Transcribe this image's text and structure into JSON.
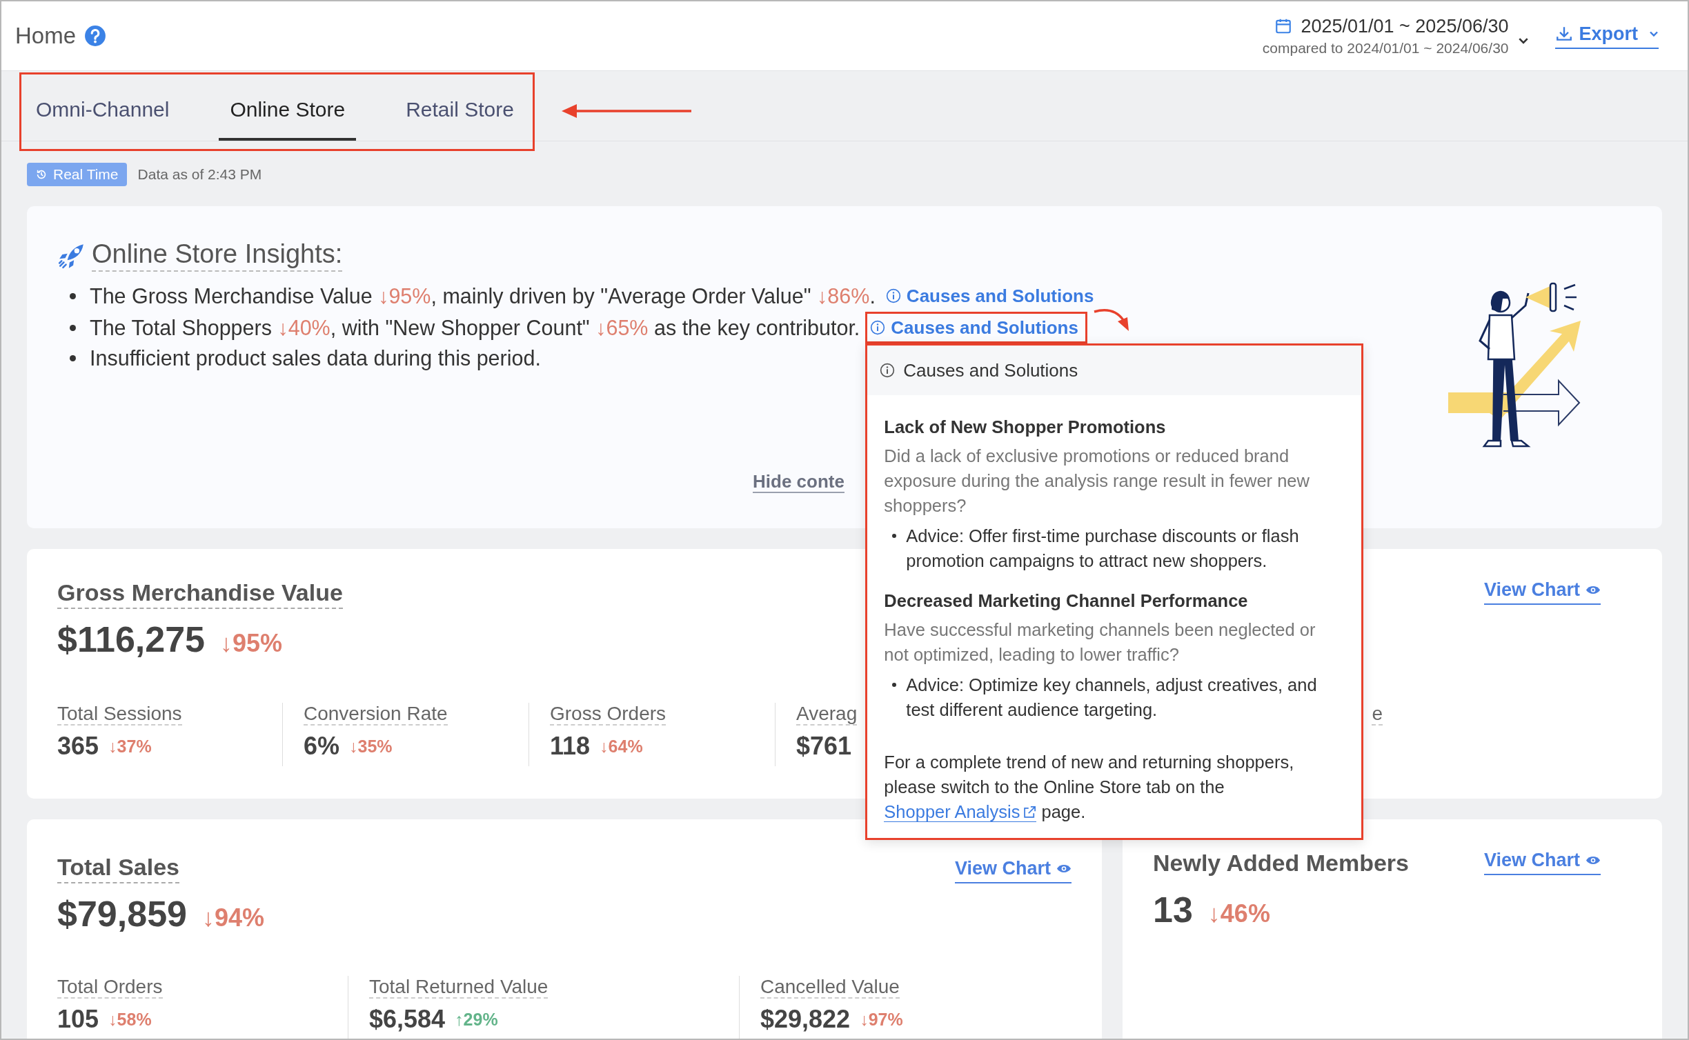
{
  "header": {
    "title": "Home",
    "date_range": "2025/01/01 ~ 2025/06/30",
    "comparison": "compared to 2024/01/01 ~ 2024/06/30",
    "export": "Export"
  },
  "tabs": [
    {
      "label": "Omni-Channel",
      "selected": false
    },
    {
      "label": "Online Store",
      "selected": true
    },
    {
      "label": "Retail Store",
      "selected": false
    }
  ],
  "status": {
    "badge": "Real Time",
    "as_of": "Data as of 2:43 PM"
  },
  "insights": {
    "title": "Online Store Insights:",
    "bullets": [
      {
        "parts": [
          {
            "kind": "text",
            "text": "The Gross Merchandise Value "
          },
          {
            "kind": "trend",
            "text": "↓95%",
            "color": "#de7f6e"
          },
          {
            "kind": "text",
            "text": ", mainly driven by \"Average Order Value\" "
          },
          {
            "kind": "trend",
            "text": "↓86%",
            "color": "#de7f6e"
          },
          {
            "kind": "text",
            "text": "."
          }
        ],
        "link": "Causes and Solutions",
        "popover_open": false
      },
      {
        "parts": [
          {
            "kind": "text",
            "text": "The Total Shoppers "
          },
          {
            "kind": "trend",
            "text": "↓40%",
            "color": "#de7f6e"
          },
          {
            "kind": "text",
            "text": ", with \"New Shopper Count\" "
          },
          {
            "kind": "trend",
            "text": "↓65%",
            "color": "#de7f6e"
          },
          {
            "kind": "text",
            "text": " as the key contributor."
          }
        ],
        "link": "Causes and Solutions",
        "popover_open": true
      },
      {
        "parts": [
          {
            "kind": "text",
            "text": "Insufficient product sales data during this period."
          }
        ]
      }
    ],
    "hide_toggle": "Hide conte"
  },
  "popover": {
    "title": "Causes and Solutions",
    "sections": [
      {
        "heading": "Lack of New Shopper Promotions",
        "question": "Did a lack of exclusive promotions or reduced brand exposure during the analysis range result in fewer new shoppers?",
        "advice": "Advice: Offer first-time purchase discounts or flash promotion campaigns to attract new shoppers."
      },
      {
        "heading": "Decreased Marketing Channel Performance",
        "question": "Have successful marketing channels been neglected or not optimized, leading to lower traffic?",
        "advice": "Advice: Optimize key channels, adjust creatives, and test different audience targeting."
      }
    ],
    "footer": "For a complete trend of new and returning shoppers, please switch to the Online Store tab on the ",
    "link": "Shopper Analysis",
    "footer_end": " page."
  },
  "gmv_card": {
    "title": "Gross Merchandise Value",
    "value": "$116,275",
    "trend": {
      "text": "↓95%",
      "color": "#de7f6e"
    },
    "view_chart": "View Chart",
    "metrics": [
      {
        "label": "Total Sessions",
        "value": "365",
        "trend": {
          "text": "↓37%",
          "color": "#de7f6e"
        }
      },
      {
        "label": "Conversion Rate",
        "value": "6%",
        "trend": {
          "text": "↓35%",
          "color": "#de7f6e"
        }
      },
      {
        "label": "Gross Orders",
        "value": "118",
        "trend": {
          "text": "↓64%",
          "color": "#de7f6e"
        }
      },
      {
        "label": "Averag",
        "value": "$761"
      },
      {
        "label": "e"
      }
    ]
  },
  "sales_card": {
    "title": "Total Sales",
    "value": "$79,859",
    "trend": {
      "text": "↓94%",
      "color": "#de7f6e"
    },
    "view_chart": "View Chart",
    "metrics": [
      {
        "label": "Total Orders",
        "value": "105",
        "trend": {
          "text": "↓58%",
          "color": "#de7f6e"
        }
      },
      {
        "label": "Total Returned Value",
        "value": "$6,584",
        "trend": {
          "text": "↑29%",
          "color": "#63b48a"
        }
      },
      {
        "label": "Cancelled Value",
        "value": "$29,822",
        "trend": {
          "text": "↓97%",
          "color": "#de7f6e"
        }
      }
    ]
  },
  "members_card": {
    "title": "Newly Added Members",
    "value": "13",
    "trend": {
      "text": "↓46%",
      "color": "#de7f6e"
    },
    "view_chart": "View Chart"
  }
}
